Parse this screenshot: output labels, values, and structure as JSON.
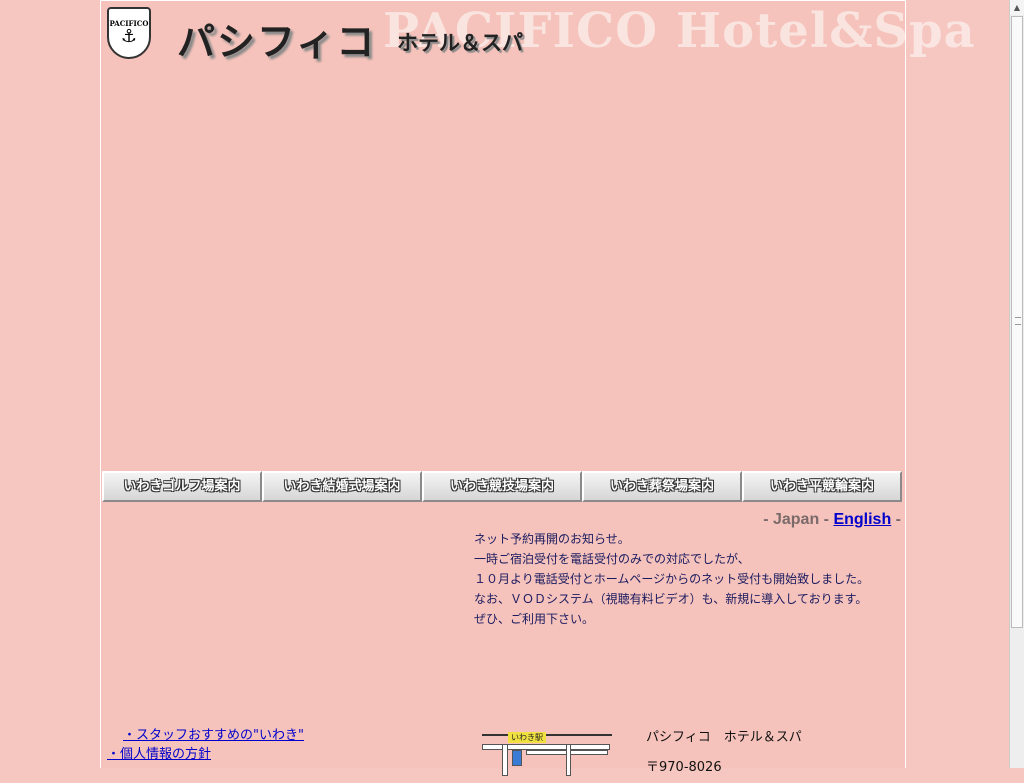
{
  "header": {
    "watermark": "PACIFICO Hotel&Spa",
    "brand_ja": "パシフィコ",
    "brand_sub": "ホテル＆スパ",
    "logo_text": "PACIFICO",
    "logo_icon": "anchor-icon"
  },
  "nav": [
    {
      "label": "いわきゴルフ場案内"
    },
    {
      "label": "いわき結婚式場案内"
    },
    {
      "label": "いわき競技場案内"
    },
    {
      "label": "いわき葬祭場案内"
    },
    {
      "label": "いわき平競輪案内"
    }
  ],
  "lang": {
    "prefix": "- Japan - ",
    "english": "English",
    "suffix": " -"
  },
  "notice": [
    "ネット予約再開のお知らせ。",
    "一時ご宿泊受付を電話受付のみでの対応でしたが、",
    "１０月より電話受付とホームページからのネット受付も開始致しました。",
    "なお、ＶＯＤシステム（視聴有料ビデオ）も、新規に導入しております。",
    "ぜひ、ご利用下さい。"
  ],
  "links": {
    "staff": "・スタッフおすすめの\"いわき\"",
    "privacy": "・個人情報の方針"
  },
  "map": {
    "station": "いわき駅"
  },
  "address": {
    "name": "パシフィコ　ホテル＆スパ",
    "postal": "〒970-8026"
  }
}
